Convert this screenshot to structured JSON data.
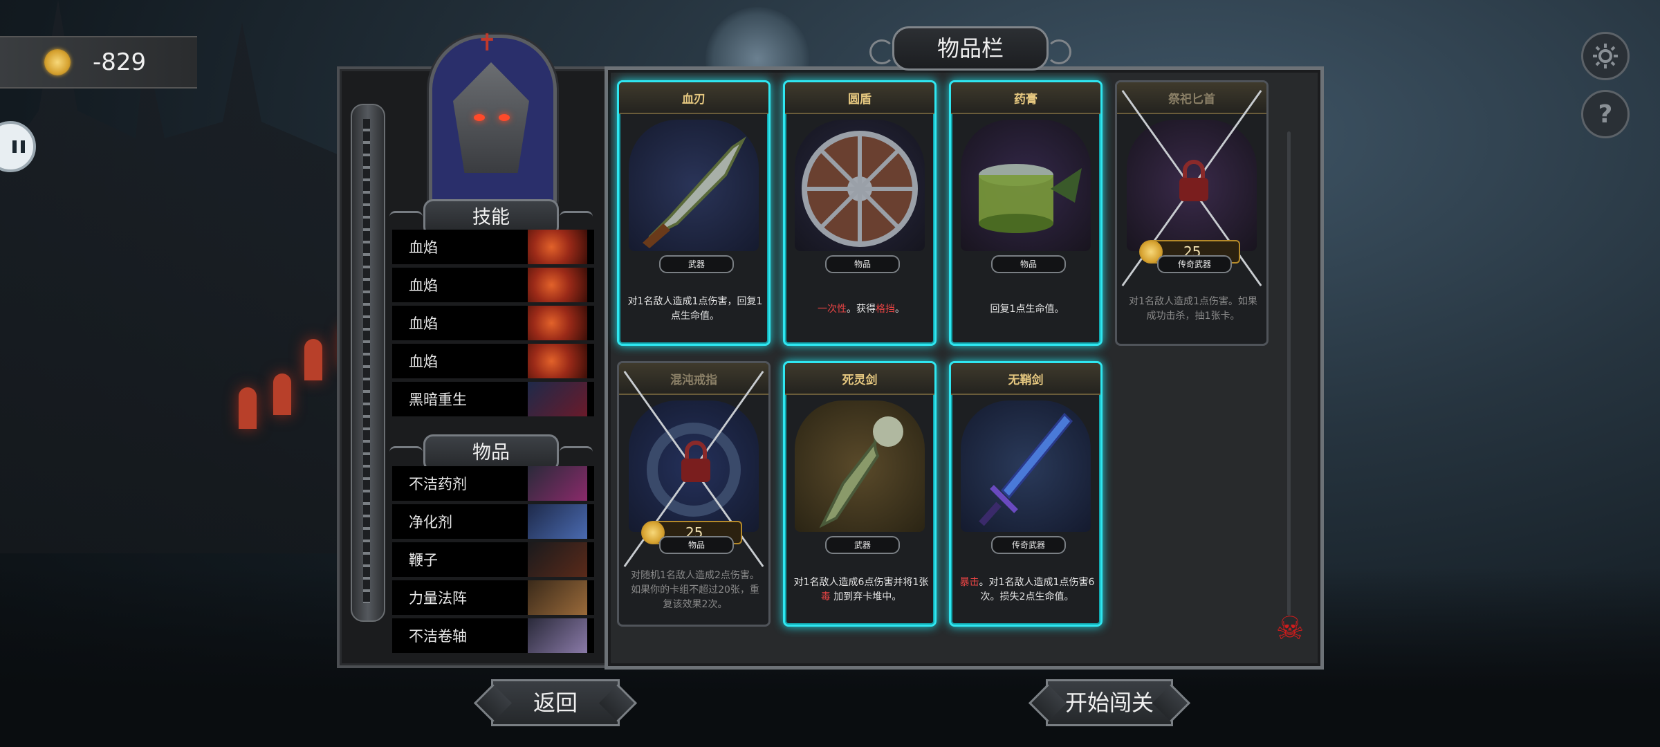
{
  "gold": {
    "value": "-829"
  },
  "colors": {
    "accent": "#2fe6f0",
    "gold": "#d6a230",
    "danger": "#e84444",
    "card_title": "#e6c880"
  },
  "icons": {
    "coin": "gold-coin-icon",
    "pause": "pause-icon",
    "settings": "gear-icon",
    "help": "question-icon",
    "skull": "skull-icon"
  },
  "help": {
    "symbol": "?"
  },
  "skills_header": "技能",
  "skills": [
    {
      "label": "血焰",
      "thumb": "blood-flame"
    },
    {
      "label": "血焰",
      "thumb": "blood-flame"
    },
    {
      "label": "血焰",
      "thumb": "blood-flame"
    },
    {
      "label": "血焰",
      "thumb": "blood-flame"
    },
    {
      "label": "黑暗重生",
      "thumb": "dark-rebirth"
    }
  ],
  "items_header": "物品",
  "items": [
    {
      "label": "不洁药剂",
      "thumb": "potion"
    },
    {
      "label": "净化剂",
      "thumb": "vial"
    },
    {
      "label": "鞭子",
      "thumb": "whip"
    },
    {
      "label": "力量法阵",
      "thumb": "rune"
    },
    {
      "label": "不洁卷轴",
      "thumb": "scroll"
    }
  ],
  "inventory": {
    "title": "物品栏",
    "cards": [
      {
        "title": "血刃",
        "type": "武器",
        "desc": "对1名敌人造成1点伤害，回复1点生命值。",
        "selected": true,
        "locked": false
      },
      {
        "title": "圆盾",
        "type": "物品",
        "desc_red1": "一次性",
        "desc_mid": "。获得",
        "desc_red2": "格挡",
        "desc_end": "。",
        "selected": true,
        "locked": false
      },
      {
        "title": "药膏",
        "type": "物品",
        "desc": "回复1点生命值。",
        "selected": true,
        "locked": false
      },
      {
        "title": "祭祀匕首",
        "type": "传奇武器",
        "desc": "对1名敌人造成1点伤害。如果成功击杀，抽1张卡。",
        "selected": false,
        "locked": true,
        "price": "25"
      },
      {
        "title": "混沌戒指",
        "type": "物品",
        "desc": "对随机1名敌人造成2点伤害。如果你的卡组不超过20张，重复该效果2次。",
        "selected": false,
        "locked": true,
        "price": "25"
      },
      {
        "title": "死灵剑",
        "type": "武器",
        "desc_pre": "对1名敌人造成6点伤害并将1张",
        "desc_red": "毒",
        "desc_post": "加到弃卡堆中。",
        "selected": true,
        "locked": false
      },
      {
        "title": "无鞘剑",
        "type": "传奇武器",
        "desc_red": "暴击",
        "desc_post": "。对1名敌人造成1点伤害6次。损失2点生命值。",
        "selected": true,
        "locked": false
      }
    ]
  },
  "buttons": {
    "back": "返回",
    "start": "开始闯关"
  }
}
